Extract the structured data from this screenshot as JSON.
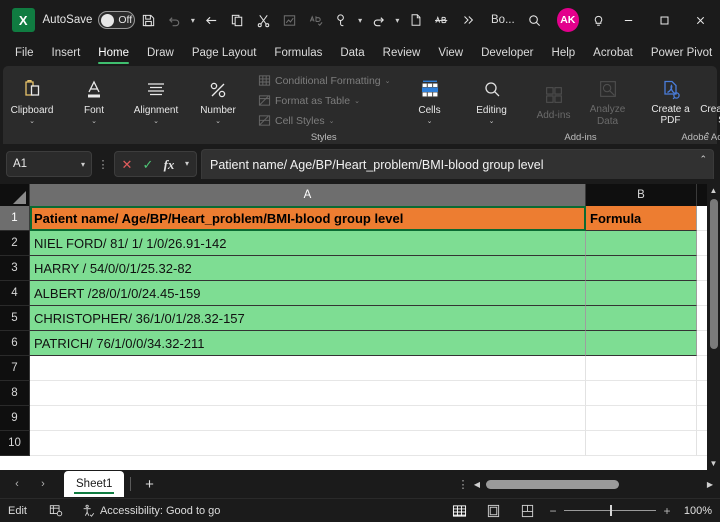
{
  "titlebar": {
    "app_logo": "excel-logo",
    "app_logo_glyph": "X",
    "autosave_label": "AutoSave",
    "autosave_state": "Off",
    "document_name": "Bo...",
    "user_initials": "AK",
    "buttons": [
      {
        "name": "save-button",
        "icon": "save-icon"
      },
      {
        "name": "undo-button",
        "icon": "undo-icon"
      },
      {
        "name": "undo-dropdown",
        "icon": "chevron-down-icon"
      },
      {
        "name": "back-button",
        "icon": "arrow-left-icon"
      },
      {
        "name": "copy-button",
        "icon": "copy-icon"
      },
      {
        "name": "cut-button",
        "icon": "scissors-icon"
      },
      {
        "name": "chart-button",
        "icon": "chart-icon"
      },
      {
        "name": "spelling-button",
        "icon": "spelling-icon"
      },
      {
        "name": "format-painter-button",
        "icon": "format-painter-icon"
      },
      {
        "name": "redo-button",
        "icon": "redo-icon"
      },
      {
        "name": "new-doc-button",
        "icon": "document-icon"
      },
      {
        "name": "ab-button",
        "icon": "ab-icon"
      },
      {
        "name": "more-commands-button",
        "icon": "chevrons-right-icon"
      }
    ],
    "search_icon": "search-icon",
    "tips_icon": "lightbulb-icon",
    "minimize": "minimize-icon",
    "maximize": "maximize-icon",
    "close": "close-icon"
  },
  "ribbon_tabs": {
    "items": [
      {
        "label": "File",
        "active": false
      },
      {
        "label": "Insert",
        "active": false
      },
      {
        "label": "Home",
        "active": true
      },
      {
        "label": "Draw",
        "active": false
      },
      {
        "label": "Page Layout",
        "active": false
      },
      {
        "label": "Formulas",
        "active": false
      },
      {
        "label": "Data",
        "active": false
      },
      {
        "label": "Review",
        "active": false
      },
      {
        "label": "View",
        "active": false
      },
      {
        "label": "Developer",
        "active": false
      },
      {
        "label": "Help",
        "active": false
      },
      {
        "label": "Acrobat",
        "active": false
      },
      {
        "label": "Power Pivot",
        "active": false
      }
    ],
    "comments_icon": "comment-icon",
    "share_icon": "share-icon",
    "share_chevron": "chevron-down-icon",
    "accent_color": "#3fbf6f"
  },
  "ribbon": {
    "groups": [
      {
        "name": "clipboard",
        "label": "",
        "buttons": [
          {
            "label": "Clipboard",
            "icon": "clipboard-icon",
            "chevron": "⌄",
            "disabled": false
          }
        ]
      },
      {
        "name": "font",
        "label": "",
        "buttons": [
          {
            "label": "Font",
            "icon": "font-icon",
            "chevron": "⌄",
            "disabled": false
          }
        ]
      },
      {
        "name": "alignment",
        "label": "",
        "buttons": [
          {
            "label": "Alignment",
            "icon": "alignment-icon",
            "chevron": "⌄",
            "disabled": false
          }
        ]
      },
      {
        "name": "number",
        "label": "",
        "buttons": [
          {
            "label": "Number",
            "icon": "percent-icon",
            "chevron": "⌄",
            "disabled": false
          }
        ]
      }
    ],
    "styles_group": {
      "label": "Styles",
      "items": [
        {
          "label": "Conditional Formatting",
          "icon": "conditional-formatting-icon",
          "chevron": "⌄",
          "disabled": true
        },
        {
          "label": "Format as Table",
          "icon": "format-as-table-icon",
          "chevron": "⌄",
          "disabled": true
        },
        {
          "label": "Cell Styles",
          "icon": "cell-styles-icon",
          "chevron": "⌄",
          "disabled": true
        }
      ]
    },
    "cells_button": {
      "label": "Cells",
      "icon": "cells-icon",
      "chevron": "⌄"
    },
    "editing_button": {
      "label": "Editing",
      "icon": "editing-search-icon",
      "chevron": "⌄"
    },
    "addins_group": {
      "label": "Add-ins",
      "items": [
        {
          "label": "Add-ins",
          "icon": "add-ins-icon",
          "disabled": true
        },
        {
          "label": "Analyze Data",
          "icon": "analyze-data-icon",
          "disabled": true
        }
      ]
    },
    "acrobat_group": {
      "label": "Adobe Acrobat",
      "items": [
        {
          "label": "Create a PDF",
          "icon": "create-pdf-icon",
          "disabled": false
        },
        {
          "label": "Create a PDF and Share link",
          "icon": "create-pdf-share-icon",
          "disabled": false
        }
      ]
    },
    "collapse_icon": "chevron-up-icon"
  },
  "formula_bar": {
    "name_box_value": "A1",
    "name_box_chevron": "chevron-down-icon",
    "overflow_icon": "more-vertical-icon",
    "cancel_icon": "cancel-x-icon",
    "enter_icon": "enter-check-icon",
    "function_icon": "fx-icon",
    "function_chevron": "chevron-down-icon",
    "value": "Patient name/ Age/BP/Heart_problem/BMI-blood group level",
    "expand_icon": "chevron-up-icon"
  },
  "grid": {
    "select_all_icon": "select-all-corner-icon",
    "columns": [
      {
        "label": "A",
        "selected": true
      },
      {
        "label": "B",
        "selected": false
      }
    ],
    "header_fill": "#ED7D31",
    "data_fill": "#7EDD93",
    "rows": [
      {
        "num": "1",
        "a": "Patient name/ Age/BP/Heart_problem/BMI-blood group level",
        "b": "Formula",
        "style": "header",
        "selected": true
      },
      {
        "num": "2",
        "a": "NIEL FORD/ 81/ 1/ 1/0/26.91-142",
        "b": "",
        "style": "data",
        "selected": false
      },
      {
        "num": "3",
        "a": "HARRY / 54/0/0/1/25.32-82",
        "b": "",
        "style": "data",
        "selected": false
      },
      {
        "num": "4",
        "a": "ALBERT /28/0/1/0/24.45-159",
        "b": "",
        "style": "data",
        "selected": false
      },
      {
        "num": "5",
        "a": "CHRISTOPHER/ 36/1/0/1/28.32-157",
        "b": "",
        "style": "data",
        "selected": false
      },
      {
        "num": "6",
        "a": "PATRICH/ 76/1/0/0/34.32-211",
        "b": "",
        "style": "data",
        "selected": false
      },
      {
        "num": "7",
        "a": "",
        "b": "",
        "style": "empty",
        "selected": false
      },
      {
        "num": "8",
        "a": "",
        "b": "",
        "style": "empty",
        "selected": false
      },
      {
        "num": "9",
        "a": "",
        "b": "",
        "style": "empty",
        "selected": false
      },
      {
        "num": "10",
        "a": "",
        "b": "",
        "style": "empty",
        "selected": false
      }
    ],
    "vscroll_up_icon": "chevron-up-icon",
    "vscroll_down_icon": "chevron-down-icon"
  },
  "sheetbar": {
    "prev_icon": "chevron-left-icon",
    "next_icon": "chevron-right-icon",
    "tabs": [
      {
        "label": "Sheet1",
        "active": true
      }
    ],
    "add_sheet_icon": "plus-icon",
    "overflow_icon": "more-vertical-icon",
    "hscroll_left_icon": "triangle-left-icon",
    "hscroll_right_icon": "triangle-right-icon"
  },
  "statusbar": {
    "mode": "Edit",
    "macro_icon": "record-macro-icon",
    "accessibility_icon": "accessibility-icon",
    "accessibility_text": "Accessibility: Good to go",
    "views": [
      {
        "name": "normal-view-button",
        "icon": "normal-view-icon",
        "active": true
      },
      {
        "name": "page-layout-view-button",
        "icon": "page-layout-view-icon",
        "active": false
      },
      {
        "name": "page-break-view-button",
        "icon": "page-break-view-icon",
        "active": false
      }
    ],
    "zoom_out_label": "−",
    "zoom_in_label": "+",
    "zoom_level": "100%"
  }
}
